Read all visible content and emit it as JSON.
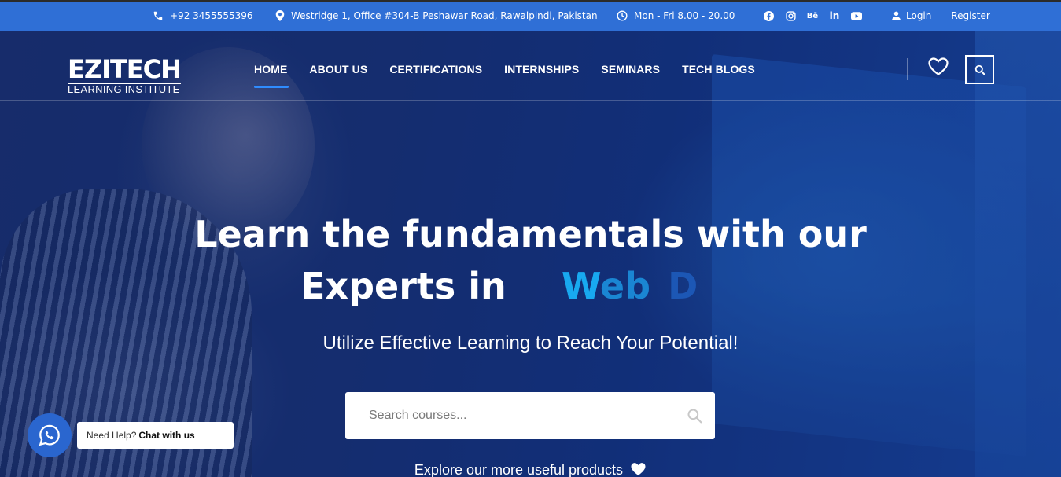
{
  "topbar": {
    "phone": "+92 3455555396",
    "address": "Westridge 1, Office #304-B Peshawar Road, Rawalpindi, Pakistan",
    "hours": "Mon - Fri 8.00 - 20.00",
    "social_icons": [
      "facebook-icon",
      "instagram-icon",
      "behance-icon",
      "linkedin-icon",
      "youtube-icon"
    ],
    "behance_text": "Bē",
    "linkedin_text": "in",
    "login": "Login",
    "register": "Register"
  },
  "logo": {
    "brand": "EZITECH",
    "sub": "LEARNING INSTITUTE"
  },
  "nav": {
    "items": [
      "HOME",
      "ABOUT US",
      "CERTIFICATIONS",
      "INTERNSHIPS",
      "SEMINARS",
      "TECH BLOGS"
    ],
    "active": "HOME"
  },
  "hero": {
    "headline_line1": "Learn the fundamentals with our",
    "headline_line2": "Experts in",
    "rotating_text": {
      "part1": "W",
      "part2": "eb",
      "part3": "D"
    },
    "tagline": "Utilize Effective Learning to Reach Your Potential!",
    "search_placeholder": "Search courses...",
    "explore": "Explore our more useful products"
  },
  "whatsapp": {
    "prefix": "Need Help?",
    "cta": "Chat with us"
  },
  "colors": {
    "topbar": "#2f6fd6",
    "accent": "#2f8cff",
    "rotating_1": "#18a9f0",
    "rotating_2": "#1a86d3",
    "rotating_3": "#1c57b5"
  }
}
